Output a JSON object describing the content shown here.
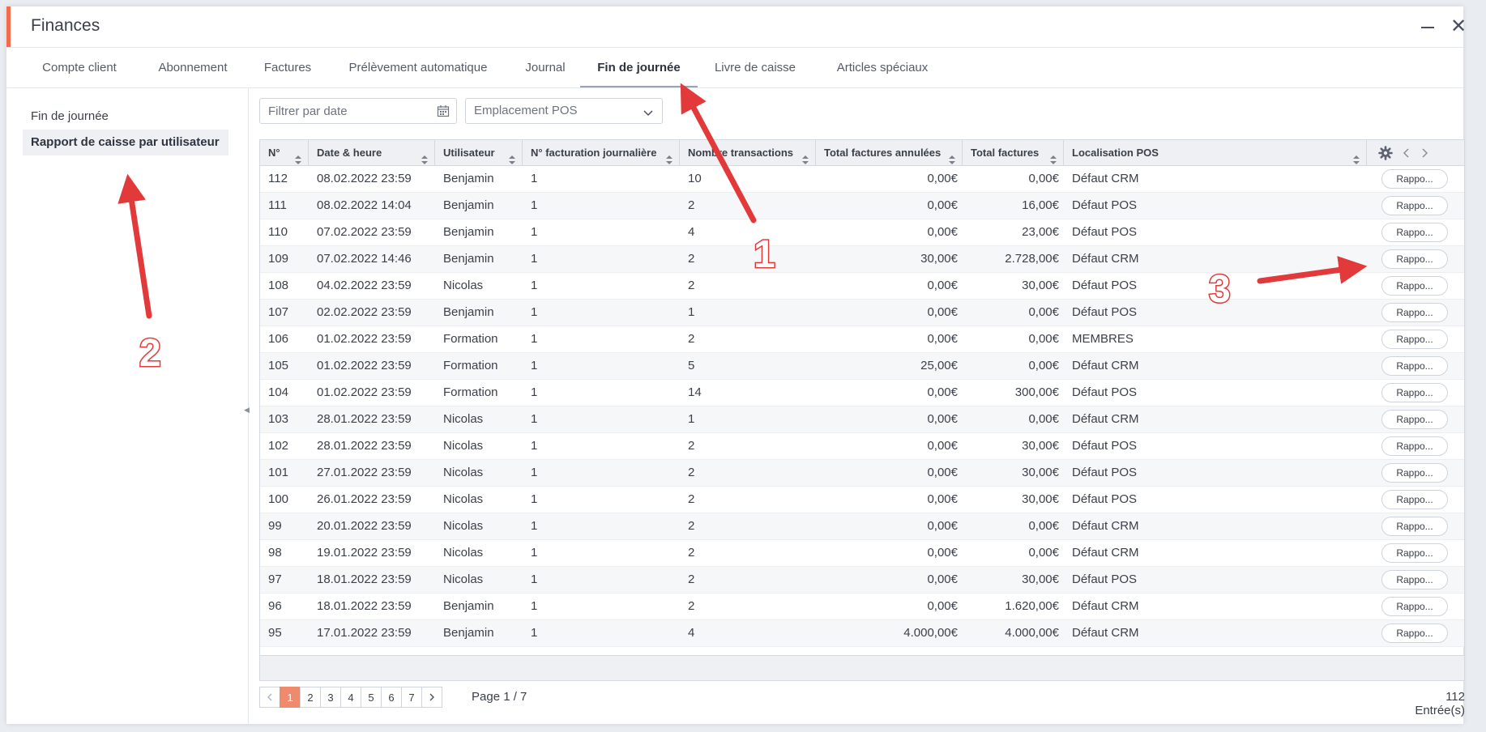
{
  "window": {
    "title": "Finances"
  },
  "tabs": [
    {
      "label": "Compte client"
    },
    {
      "label": "Abonnement"
    },
    {
      "label": "Factures"
    },
    {
      "label": "Prélèvement automatique"
    },
    {
      "label": "Journal"
    },
    {
      "label": "Fin de journée",
      "active": true
    },
    {
      "label": "Livre de caisse"
    },
    {
      "label": "Articles spéciaux"
    }
  ],
  "sidebar": {
    "items": [
      {
        "label": "Fin de journée"
      },
      {
        "label": "Rapport de caisse par utilisateur",
        "active": true
      }
    ]
  },
  "filters": {
    "date_placeholder": "Filtrer par date",
    "pos_label": "Emplacement POS"
  },
  "table": {
    "columns": [
      "N°",
      "Date & heure",
      "Utilisateur",
      "N° facturation journalière",
      "Nombre transactions",
      "Total factures annulées",
      "Total factures",
      "Localisation POS"
    ],
    "report_label": "Rappo...",
    "rows": [
      [
        "112",
        "08.02.2022 23:59",
        "Benjamin",
        "1",
        "10",
        "0,00€",
        "0,00€",
        "Défaut CRM"
      ],
      [
        "111",
        "08.02.2022 14:04",
        "Benjamin",
        "1",
        "2",
        "0,00€",
        "16,00€",
        "Défaut POS"
      ],
      [
        "110",
        "07.02.2022 23:59",
        "Benjamin",
        "1",
        "4",
        "0,00€",
        "23,00€",
        "Défaut POS"
      ],
      [
        "109",
        "07.02.2022 14:46",
        "Benjamin",
        "1",
        "2",
        "30,00€",
        "2.728,00€",
        "Défaut CRM"
      ],
      [
        "108",
        "04.02.2022 23:59",
        "Nicolas",
        "1",
        "2",
        "0,00€",
        "30,00€",
        "Défaut POS"
      ],
      [
        "107",
        "02.02.2022 23:59",
        "Benjamin",
        "1",
        "1",
        "0,00€",
        "0,00€",
        "Défaut POS"
      ],
      [
        "106",
        "01.02.2022 23:59",
        "Formation",
        "1",
        "2",
        "0,00€",
        "0,00€",
        "MEMBRES"
      ],
      [
        "105",
        "01.02.2022 23:59",
        "Formation",
        "1",
        "5",
        "25,00€",
        "0,00€",
        "Défaut CRM"
      ],
      [
        "104",
        "01.02.2022 23:59",
        "Formation",
        "1",
        "14",
        "0,00€",
        "300,00€",
        "Défaut POS"
      ],
      [
        "103",
        "28.01.2022 23:59",
        "Nicolas",
        "1",
        "1",
        "0,00€",
        "0,00€",
        "Défaut CRM"
      ],
      [
        "102",
        "28.01.2022 23:59",
        "Nicolas",
        "1",
        "2",
        "0,00€",
        "30,00€",
        "Défaut POS"
      ],
      [
        "101",
        "27.01.2022 23:59",
        "Nicolas",
        "1",
        "2",
        "0,00€",
        "30,00€",
        "Défaut POS"
      ],
      [
        "100",
        "26.01.2022 23:59",
        "Nicolas",
        "1",
        "2",
        "0,00€",
        "30,00€",
        "Défaut POS"
      ],
      [
        "99",
        "20.01.2022 23:59",
        "Nicolas",
        "1",
        "2",
        "0,00€",
        "0,00€",
        "Défaut CRM"
      ],
      [
        "98",
        "19.01.2022 23:59",
        "Nicolas",
        "1",
        "2",
        "0,00€",
        "0,00€",
        "Défaut CRM"
      ],
      [
        "97",
        "18.01.2022 23:59",
        "Nicolas",
        "1",
        "2",
        "0,00€",
        "30,00€",
        "Défaut POS"
      ],
      [
        "96",
        "18.01.2022 23:59",
        "Benjamin",
        "1",
        "2",
        "0,00€",
        "1.620,00€",
        "Défaut CRM"
      ],
      [
        "95",
        "17.01.2022 23:59",
        "Benjamin",
        "1",
        "4",
        "4.000,00€",
        "4.000,00€",
        "Défaut CRM"
      ]
    ]
  },
  "pagination": {
    "pages": [
      "1",
      "2",
      "3",
      "4",
      "5",
      "6",
      "7"
    ],
    "current": "1",
    "page_info": "Page 1 / 7",
    "entries": "112 Entrée(s)"
  },
  "annotations": [
    "1",
    "2",
    "3"
  ],
  "colors": {
    "accent": "#f26b4c",
    "annotation_arrow": "#e23a3a",
    "active_page": "#f08a6c"
  },
  "icons": [
    "minimize-icon",
    "close-icon",
    "calendar-icon",
    "chevron-down-icon",
    "sort-icon",
    "gear-icon",
    "chevron-left-icon",
    "chevron-right-icon"
  ]
}
